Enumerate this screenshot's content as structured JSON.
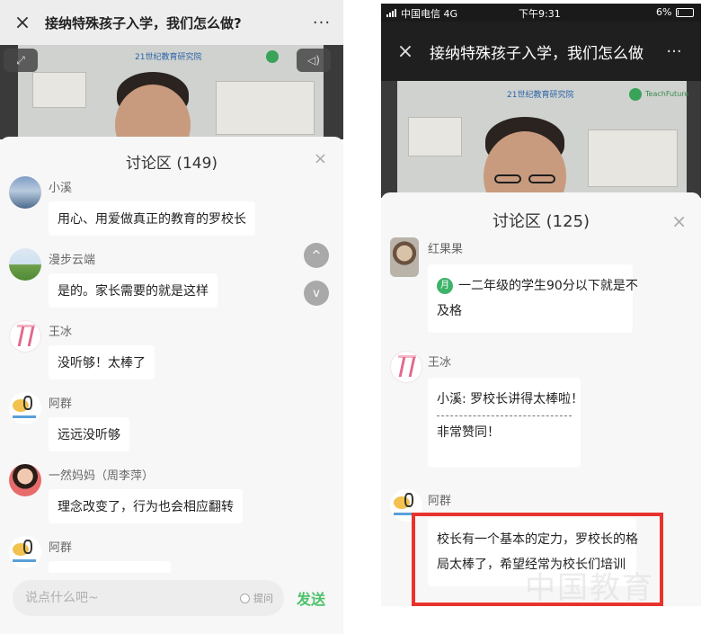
{
  "left": {
    "title": "接纳特殊孩子入学，我们怎么做?",
    "close_icon": "×",
    "more_icon": "···",
    "video": {
      "logo_text": "21世纪教育研究院"
    },
    "panel": {
      "title": "讨论区 (149)",
      "close_icon": "×",
      "comments": [
        {
          "user": "小溪",
          "text": "用心、用爱做真正的教育的罗校长",
          "avatar": "sea"
        },
        {
          "user": "漫步云端",
          "text": "是的。家长需要的就是这样",
          "avatar": "field"
        },
        {
          "user": "王冰",
          "text": "没听够！太棒了",
          "avatar": "pink"
        },
        {
          "user": "阿群",
          "text": "远远没听够",
          "avatar": "cartoon"
        },
        {
          "user": "一然妈妈（周李萍）",
          "text": "理念改变了，行为也会相应翻转",
          "avatar": "woman"
        },
        {
          "user": "阿群",
          "text": "",
          "avatar": "cartoon"
        }
      ]
    },
    "scroll_up_icon": "^",
    "scroll_down_icon": "v",
    "input": {
      "placeholder": "说点什么吧~",
      "ask_label": "提问",
      "send_label": "发送"
    }
  },
  "right": {
    "status": {
      "carrier": "中国电信  4G",
      "time": "下午9:31",
      "battery": "6%",
      "battery_level": 0.06
    },
    "title": "接纳特殊孩子入学，我们怎么做",
    "close_icon": "×",
    "more_icon": "···",
    "video": {
      "logo_text": "21世纪教育研究院",
      "logo_text_2": "TeachFuture"
    },
    "panel": {
      "title": "讨论区 (125)",
      "close_icon": "×",
      "comments": [
        {
          "user": "红果果",
          "badge": "月",
          "line1": "一二年级的学生90分以下就是不",
          "line2": "及格"
        },
        {
          "user": "王冰",
          "quote": "小溪: 罗校长讲得太棒啦！",
          "reply": "非常赞同！"
        },
        {
          "user": "阿群",
          "line1": "校长有一个基本的定力，罗校长的格",
          "line2": "局太棒了，希望经常为校长们培训"
        }
      ]
    },
    "watermark": "中国教育"
  },
  "colors": {
    "send_green": "#4cc26b",
    "highlight_red": "#e8332d"
  }
}
